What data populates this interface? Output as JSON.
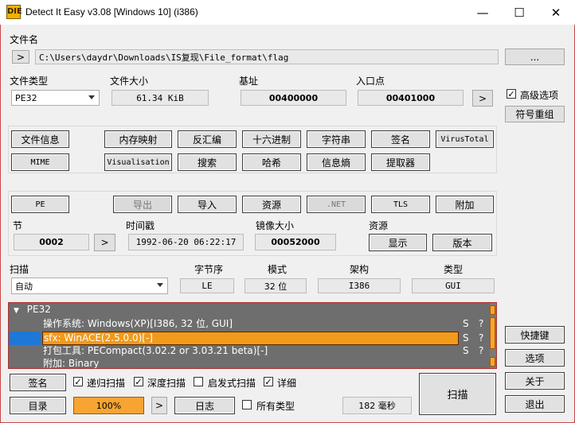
{
  "titlebar": {
    "title": "Detect It Easy v3.08 [Windows 10] (i386)",
    "icon": "DIE"
  },
  "file": {
    "label": "文件名",
    "path": "C:\\Users\\daydr\\Downloads\\IS复现\\File_format\\flag",
    "browse": "...",
    "expand": ">"
  },
  "info": {
    "type_label": "文件类型",
    "type_value": "PE32",
    "size_label": "文件大小",
    "size_value": "61.34 KiB",
    "base_label": "基址",
    "base_value": "00400000",
    "entry_label": "入口点",
    "entry_value": "00401000",
    "entry_btn": ">"
  },
  "right": {
    "advanced_label": "高级选项",
    "advanced_checked": true,
    "rebuild": "符号重组"
  },
  "tools": {
    "row1": [
      "文件信息",
      "内存映射",
      "反汇编",
      "十六进制",
      "字符串",
      "签名",
      "VirusTotal"
    ],
    "row2": [
      "MIME",
      "Visualisation",
      "搜索",
      "哈希",
      "信息熵",
      "提取器"
    ]
  },
  "pe": {
    "buttons": [
      "PE",
      "导出",
      "导入",
      "资源",
      ".NET",
      "TLS",
      "附加"
    ],
    "section_label": "节",
    "section_value": "0002",
    "section_btn": ">",
    "time_label": "时间戳",
    "time_value": "1992-06-20 06:22:17",
    "image_label": "镜像大小",
    "image_value": "00052000",
    "res_label": "资源",
    "res_show": "显示",
    "res_version": "版本"
  },
  "scan": {
    "label": "扫描",
    "mode": "自动",
    "endian_label": "字节序",
    "endian": "LE",
    "mode_label": "模式",
    "bits": "32 位",
    "arch_label": "架构",
    "arch": "I386",
    "type_label": "类型",
    "type": "GUI"
  },
  "results": {
    "root": "PE32",
    "rows": [
      {
        "text": "操作系统: Windows(XP)[I386, 32 位, GUI]",
        "s": "S",
        "q": "?",
        "selected": false
      },
      {
        "text": "sfx: WinACE(2.5.0.0)[-]",
        "s": "S",
        "q": "?",
        "selected": true
      },
      {
        "text": "打包工具: PECompact(3.02.2 or 3.03.21 beta)[-]",
        "s": "S",
        "q": "?",
        "selected": false
      },
      {
        "text": "附加: Binary",
        "s": "",
        "q": "",
        "selected": false
      }
    ]
  },
  "bottom": {
    "sign": "签名",
    "recursive": "递归扫描",
    "deep": "深度扫描",
    "heuristic": "启发式扫描",
    "verbose": "详细",
    "dir": "目录",
    "progress": "100%",
    "progress_value": 1.0,
    "more": ">",
    "log": "日志",
    "alltypes": "所有类型",
    "time": "182 毫秒",
    "scan": "扫描"
  },
  "side": {
    "shortcuts": "快捷键",
    "options": "选项",
    "about": "关于",
    "exit": "退出"
  },
  "colors": {
    "accent_border": "#c8464a",
    "progress": "#f8a432",
    "selection": "#f29a1a",
    "tree_bg": "#6e6e6e"
  }
}
